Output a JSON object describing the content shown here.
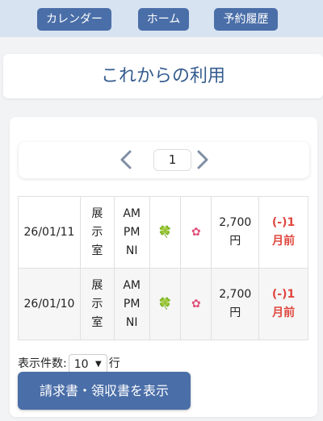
{
  "nav": {
    "calendar": "カレンダー",
    "home": "ホーム",
    "history": "予約履歴"
  },
  "page_title": "これからの利用",
  "pager": {
    "current": "1"
  },
  "reservations": [
    {
      "date": "26/01/11",
      "room": [
        "展",
        "示",
        "室"
      ],
      "slots": [
        "AM",
        "PM",
        "NI"
      ],
      "icon1": "clover-icon",
      "icon2": "flower-icon",
      "price": "2,700",
      "price_unit": "円",
      "status_line1": "(-)1",
      "status_line2": "月前"
    },
    {
      "date": "26/01/10",
      "room": [
        "展",
        "示",
        "室"
      ],
      "slots": [
        "AM",
        "PM",
        "NI"
      ],
      "icon1": "clover-icon",
      "icon2": "flower-icon",
      "price": "2,700",
      "price_unit": "円",
      "status_line1": "(-)1",
      "status_line2": "月前"
    }
  ],
  "per_page": {
    "label": "表示件数:",
    "value": "10",
    "suffix": "行"
  },
  "invoice_button": "請求書・領収書を表示",
  "colors": {
    "primary": "#4a6ea8",
    "header_bg": "#d7e3f1",
    "title": "#355c8f",
    "status": "#e0473f"
  }
}
